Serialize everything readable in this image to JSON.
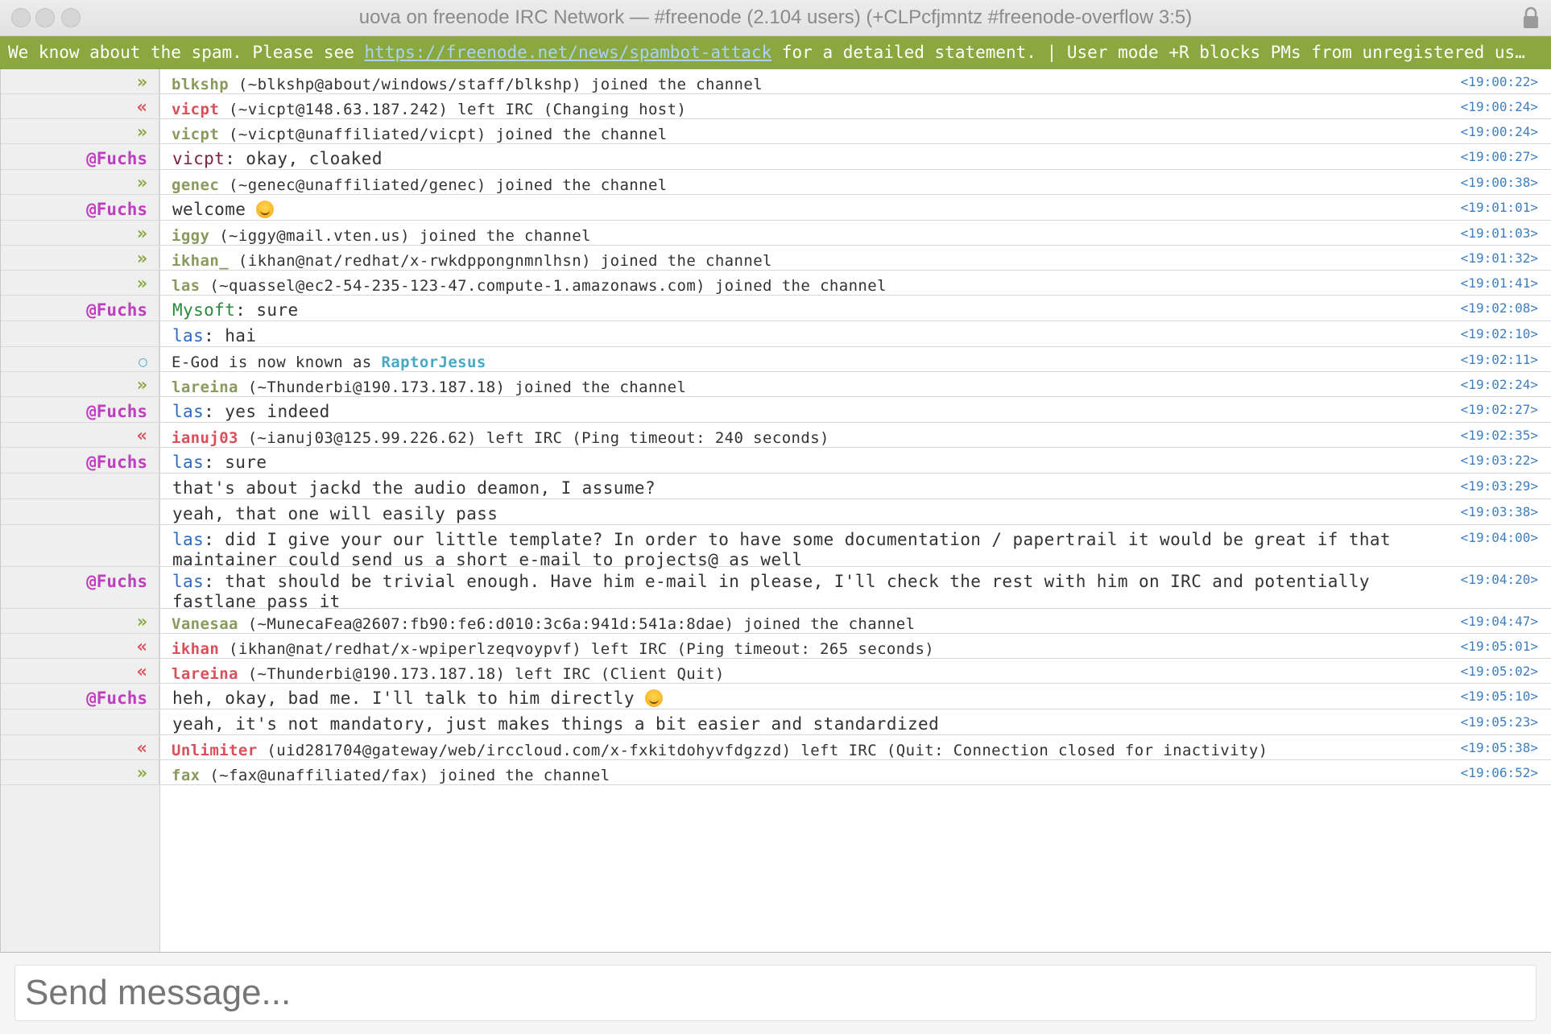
{
  "window": {
    "title": "uova on freenode IRC Network — #freenode (2.104 users) (+CLPcfjmntz #freenode-overflow 3:5)"
  },
  "topic": {
    "prefix": "We know about the spam. Please see ",
    "link": "https://freenode.net/news/spambot-attack",
    "suffix": " for a detailed statement. | User mode +R blocks PMs from unregistered us…"
  },
  "messages": [
    {
      "kind": "join",
      "marker": "»",
      "nick": "blkshp",
      "detail": " (~blkshp@about/windows/staff/blkshp) joined the channel",
      "time": "<19:00:22>"
    },
    {
      "kind": "part",
      "marker": "«",
      "nick": "vicpt",
      "detail": " (~vicpt@148.63.187.242) left IRC (Changing host)",
      "time": "<19:00:24>"
    },
    {
      "kind": "join",
      "marker": "»",
      "nick": "vicpt",
      "detail": " (~vicpt@unaffiliated/vicpt) joined the channel",
      "time": "<19:00:24>"
    },
    {
      "kind": "msg",
      "marker": "@Fuchs",
      "mention": "vicpt",
      "mention_color": "maroon",
      "body": ": okay, cloaked",
      "time": "<19:00:27>"
    },
    {
      "kind": "join",
      "marker": "»",
      "nick": "genec",
      "detail": " (~genec@unaffiliated/genec) joined the channel",
      "time": "<19:00:38>"
    },
    {
      "kind": "msg",
      "marker": "@Fuchs",
      "mention": "",
      "body": "welcome ",
      "smile": true,
      "time": "<19:01:01>"
    },
    {
      "kind": "join",
      "marker": "»",
      "nick": "iggy",
      "detail": " (~iggy@mail.vten.us) joined the channel",
      "time": "<19:01:03>"
    },
    {
      "kind": "join",
      "marker": "»",
      "nick": "ikhan_",
      "detail": " (ikhan@nat/redhat/x-rwkdppongnmnlhsn) joined the channel",
      "time": "<19:01:32>"
    },
    {
      "kind": "join",
      "marker": "»",
      "nick": "las",
      "detail": " (~quassel@ec2-54-235-123-47.compute-1.amazonaws.com) joined the channel",
      "time": "<19:01:41>"
    },
    {
      "kind": "msg",
      "marker": "@Fuchs",
      "mention": "Mysoft",
      "mention_color": "green",
      "body": ": sure",
      "time": "<19:02:08>"
    },
    {
      "kind": "msg",
      "marker": "",
      "mention": "las",
      "mention_color": "blue",
      "body": ": hai",
      "time": "<19:02:10>"
    },
    {
      "kind": "nick",
      "marker": "○",
      "old": "E-God",
      "mid": " is now known as ",
      "new": "RaptorJesus",
      "time": "<19:02:11>"
    },
    {
      "kind": "join",
      "marker": "»",
      "nick": "lareina",
      "detail": " (~Thunderbi@190.173.187.18) joined the channel",
      "time": "<19:02:24>"
    },
    {
      "kind": "msg",
      "marker": "@Fuchs",
      "mention": "las",
      "mention_color": "blue",
      "body": ": yes indeed",
      "time": "<19:02:27>"
    },
    {
      "kind": "part",
      "marker": "«",
      "nick": "ianuj03",
      "detail": " (~ianuj03@125.99.226.62) left IRC (Ping timeout: 240 seconds)",
      "time": "<19:02:35>"
    },
    {
      "kind": "msg",
      "marker": "@Fuchs",
      "mention": "las",
      "mention_color": "blue",
      "body": ": sure",
      "time": "<19:03:22>"
    },
    {
      "kind": "msg",
      "marker": "",
      "mention": "",
      "body": "that's about jackd the audio deamon, I assume?",
      "time": "<19:03:29>"
    },
    {
      "kind": "msg",
      "marker": "",
      "mention": "",
      "body": "yeah, that one will easily pass",
      "time": "<19:03:38>"
    },
    {
      "kind": "msg",
      "marker": "",
      "mention": "las",
      "mention_color": "blue",
      "body": ": did I give your our little template? In order to have some documentation / papertrail it would be great if that maintainer could send us a short e-mail to projects@ as well",
      "time": "<19:04:00>",
      "tall": true
    },
    {
      "kind": "msg",
      "marker": "@Fuchs",
      "mention": "las",
      "mention_color": "blue",
      "body": ": that should be trivial enough. Have him e-mail in please, I'll check the rest with him on IRC and potentially fastlane pass it",
      "time": "<19:04:20>",
      "tall": true
    },
    {
      "kind": "join",
      "marker": "»",
      "nick": "Vanesaa",
      "detail": " (~MunecaFea@2607:fb90:fe6:d010:3c6a:941d:541a:8dae) joined the channel",
      "time": "<19:04:47>"
    },
    {
      "kind": "part",
      "marker": "«",
      "nick": "ikhan",
      "detail": " (ikhan@nat/redhat/x-wpiperlzeqvoypvf) left IRC (Ping timeout: 265 seconds)",
      "time": "<19:05:01>"
    },
    {
      "kind": "part",
      "marker": "«",
      "nick": "lareina",
      "detail": " (~Thunderbi@190.173.187.18) left IRC (Client Quit)",
      "time": "<19:05:02>"
    },
    {
      "kind": "msg",
      "marker": "@Fuchs",
      "mention": "",
      "body": "heh, okay, bad me. I'll talk to him directly ",
      "smile": true,
      "time": "<19:05:10>"
    },
    {
      "kind": "msg",
      "marker": "",
      "mention": "",
      "body": "yeah, it's not mandatory, just makes things a bit easier and standardized",
      "time": "<19:05:23>"
    },
    {
      "kind": "part",
      "marker": "«",
      "nick": "Unlimiter",
      "detail": " (uid281704@gateway/web/irccloud.com/x-fxkitdohyvfdgzzd) left IRC (Quit: Connection closed for inactivity)",
      "time": "<19:05:38>"
    },
    {
      "kind": "join",
      "marker": "»",
      "nick": "fax",
      "detail": " (~fax@unaffiliated/fax) joined the channel",
      "time": "<19:06:52>"
    }
  ],
  "input": {
    "placeholder": "Send message..."
  },
  "colors": {
    "topic_bg": "#8aa83f",
    "nick_op": "#c03cc0",
    "timestamp": "#3f7fbf"
  }
}
